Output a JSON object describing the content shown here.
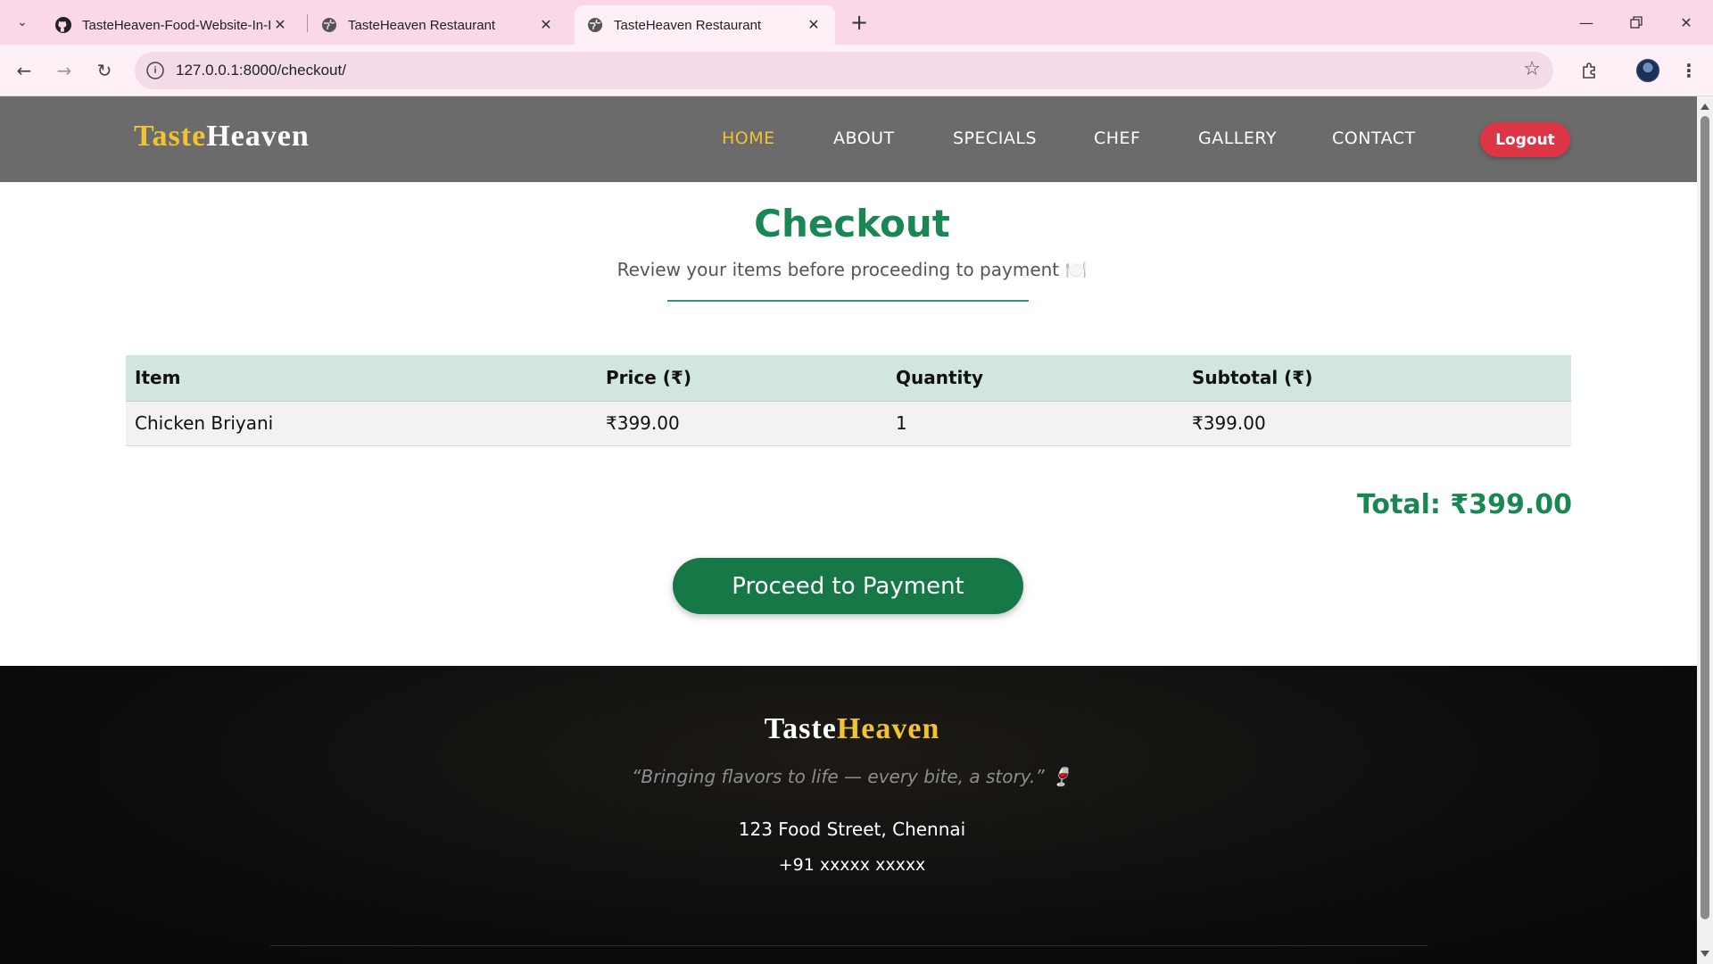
{
  "browser": {
    "tabs": [
      {
        "title": "TasteHeaven-Food-Website-In-I",
        "icon": "github-icon",
        "active": false
      },
      {
        "title": "TasteHeaven Restaurant",
        "icon": "globe-icon",
        "active": false
      },
      {
        "title": "TasteHeaven Restaurant",
        "icon": "globe-icon",
        "active": true
      }
    ],
    "url": "127.0.0.1:8000/checkout/"
  },
  "header": {
    "logo_part1": "Taste",
    "logo_part2": "Heaven",
    "nav": [
      "HOME",
      "ABOUT",
      "SPECIALS",
      "CHEF",
      "GALLERY",
      "CONTACT"
    ],
    "active_nav": "HOME",
    "logout_label": "Logout"
  },
  "checkout": {
    "title": "Checkout",
    "subtitle": "Review your items before proceeding to payment 🍽️",
    "columns": [
      "Item",
      "Price (₹)",
      "Quantity",
      "Subtotal (₹)"
    ],
    "rows": [
      {
        "item": "Chicken Briyani",
        "price": "₹399.00",
        "quantity": "1",
        "subtotal": "₹399.00"
      }
    ],
    "total": "Total: ₹399.00",
    "pay_button": "Proceed to Payment"
  },
  "footer": {
    "logo_part1": "Taste",
    "logo_part2": "Heaven",
    "tagline": "“Bringing flavors to life — every bite, a story.” 🍷",
    "address": "123 Food Street, Chennai",
    "phone": "+91 xxxxx xxxxx"
  },
  "colors": {
    "accent_green": "#198754",
    "header_bg": "#6b6b6b",
    "logo_gold": "#f2c230",
    "logout_red": "#dc3545",
    "table_header_bg": "#d1e7dd"
  }
}
